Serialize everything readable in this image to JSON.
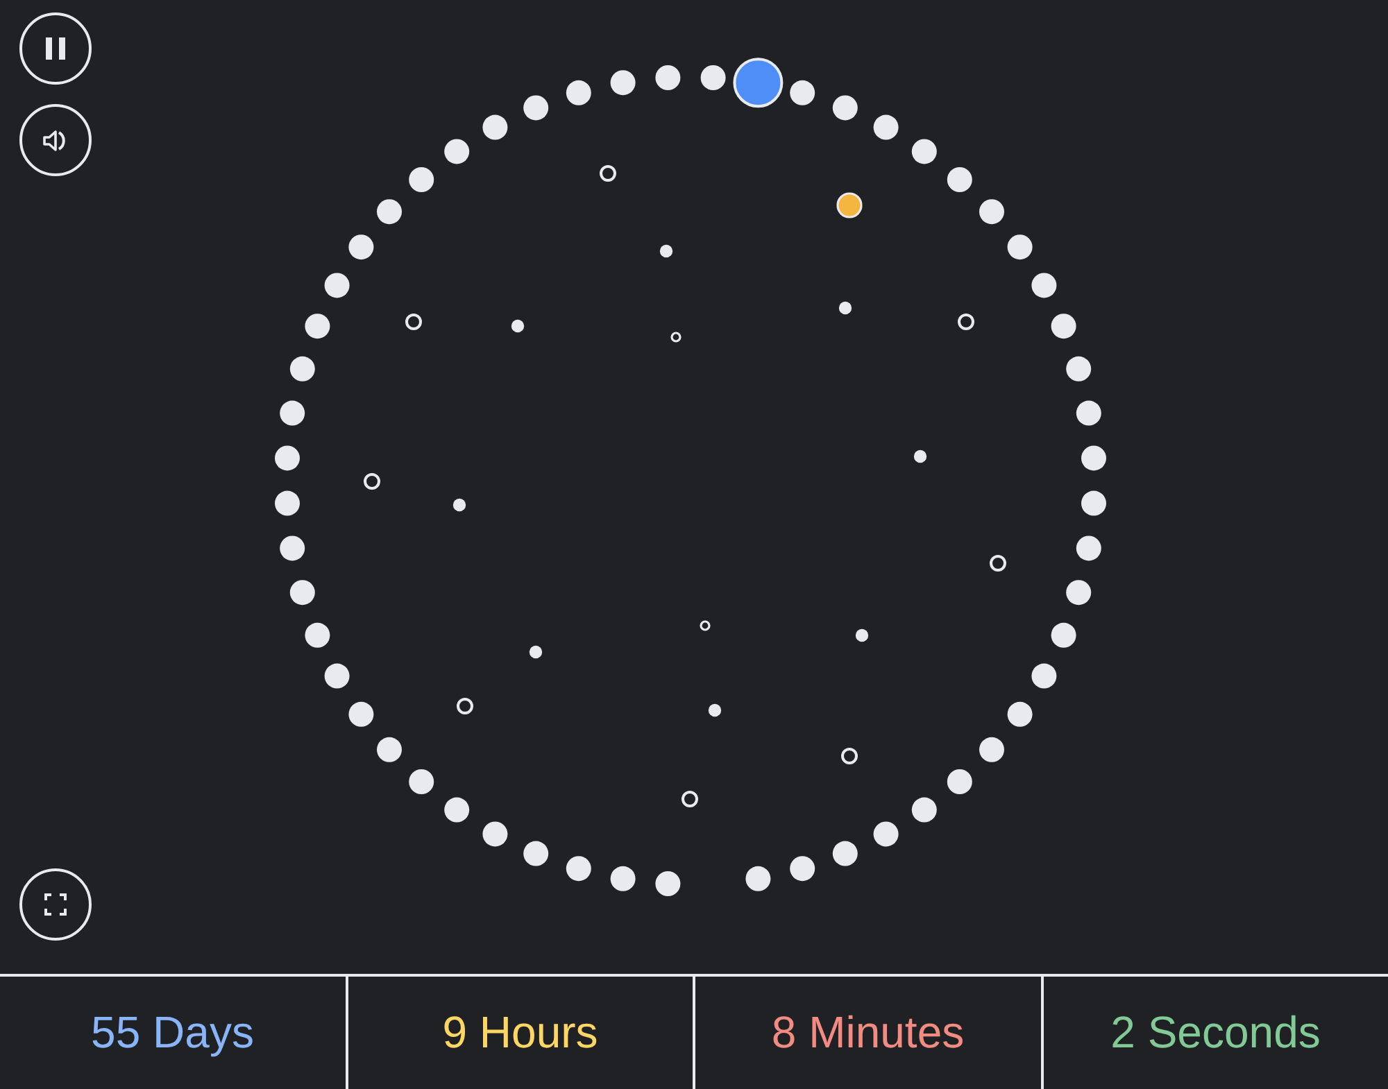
{
  "countdown": [
    {
      "label": "55 Days",
      "color": "#8ab4f8"
    },
    {
      "label": "9 Hours",
      "color": "#fdd663"
    },
    {
      "label": "8 Minutes",
      "color": "#f28b82"
    },
    {
      "label": "2 Seconds",
      "color": "#81c995"
    }
  ]
}
